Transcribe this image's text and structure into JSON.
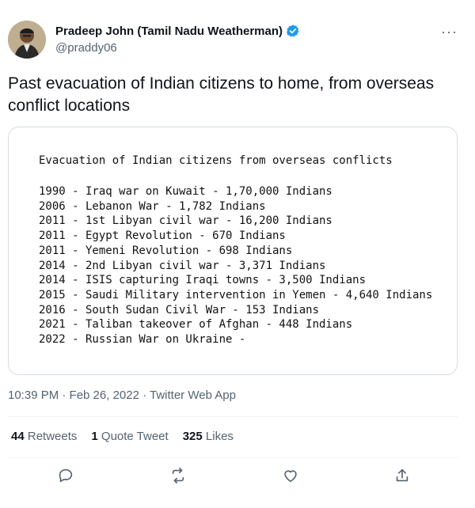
{
  "author": {
    "display_name": "Pradeep John (Tamil Nadu Weatherman)",
    "handle": "@praddy06",
    "verified": true
  },
  "more_icon": "more-dots-icon",
  "tweet_text": "Past evacuation of Indian citizens to home, from overseas conflict locations",
  "card": {
    "title": "Evacuation of Indian citizens from overseas conflicts",
    "lines": [
      "1990 - Iraq war on Kuwait - 1,70,000 Indians",
      "2006 - Lebanon War - 1,782 Indians",
      "2011 - 1st Libyan civil war - 16,200 Indians",
      "2011 - Egypt Revolution - 670 Indians",
      "2011 - Yemeni Revolution - 698 Indians",
      "2014 - 2nd Libyan civil war - 3,371 Indians",
      "2014 - ISIS capturing Iraqi towns - 3,500 Indians",
      "2015 - Saudi Military intervention in Yemen - 4,640 Indians",
      "2016 - South Sudan Civil War - 153 Indians",
      "2021 - Taliban takeover of Afghan - 448 Indians",
      "2022 - Russian War on Ukraine -"
    ]
  },
  "meta": "10:39 PM · Feb 26, 2022 · Twitter Web App",
  "stats": {
    "retweets_count": "44",
    "retweets_label": "Retweets",
    "quote_count": "1",
    "quote_label": "Quote Tweet",
    "likes_count": "325",
    "likes_label": "Likes"
  },
  "actions": {
    "reply_icon": "reply-icon",
    "retweet_icon": "retweet-icon",
    "like_icon": "like-icon",
    "share_icon": "share-icon"
  },
  "colors": {
    "verified": "#1d9bf0",
    "text": "#0f1419",
    "secondary": "#536471",
    "border": "#d5dde3"
  }
}
